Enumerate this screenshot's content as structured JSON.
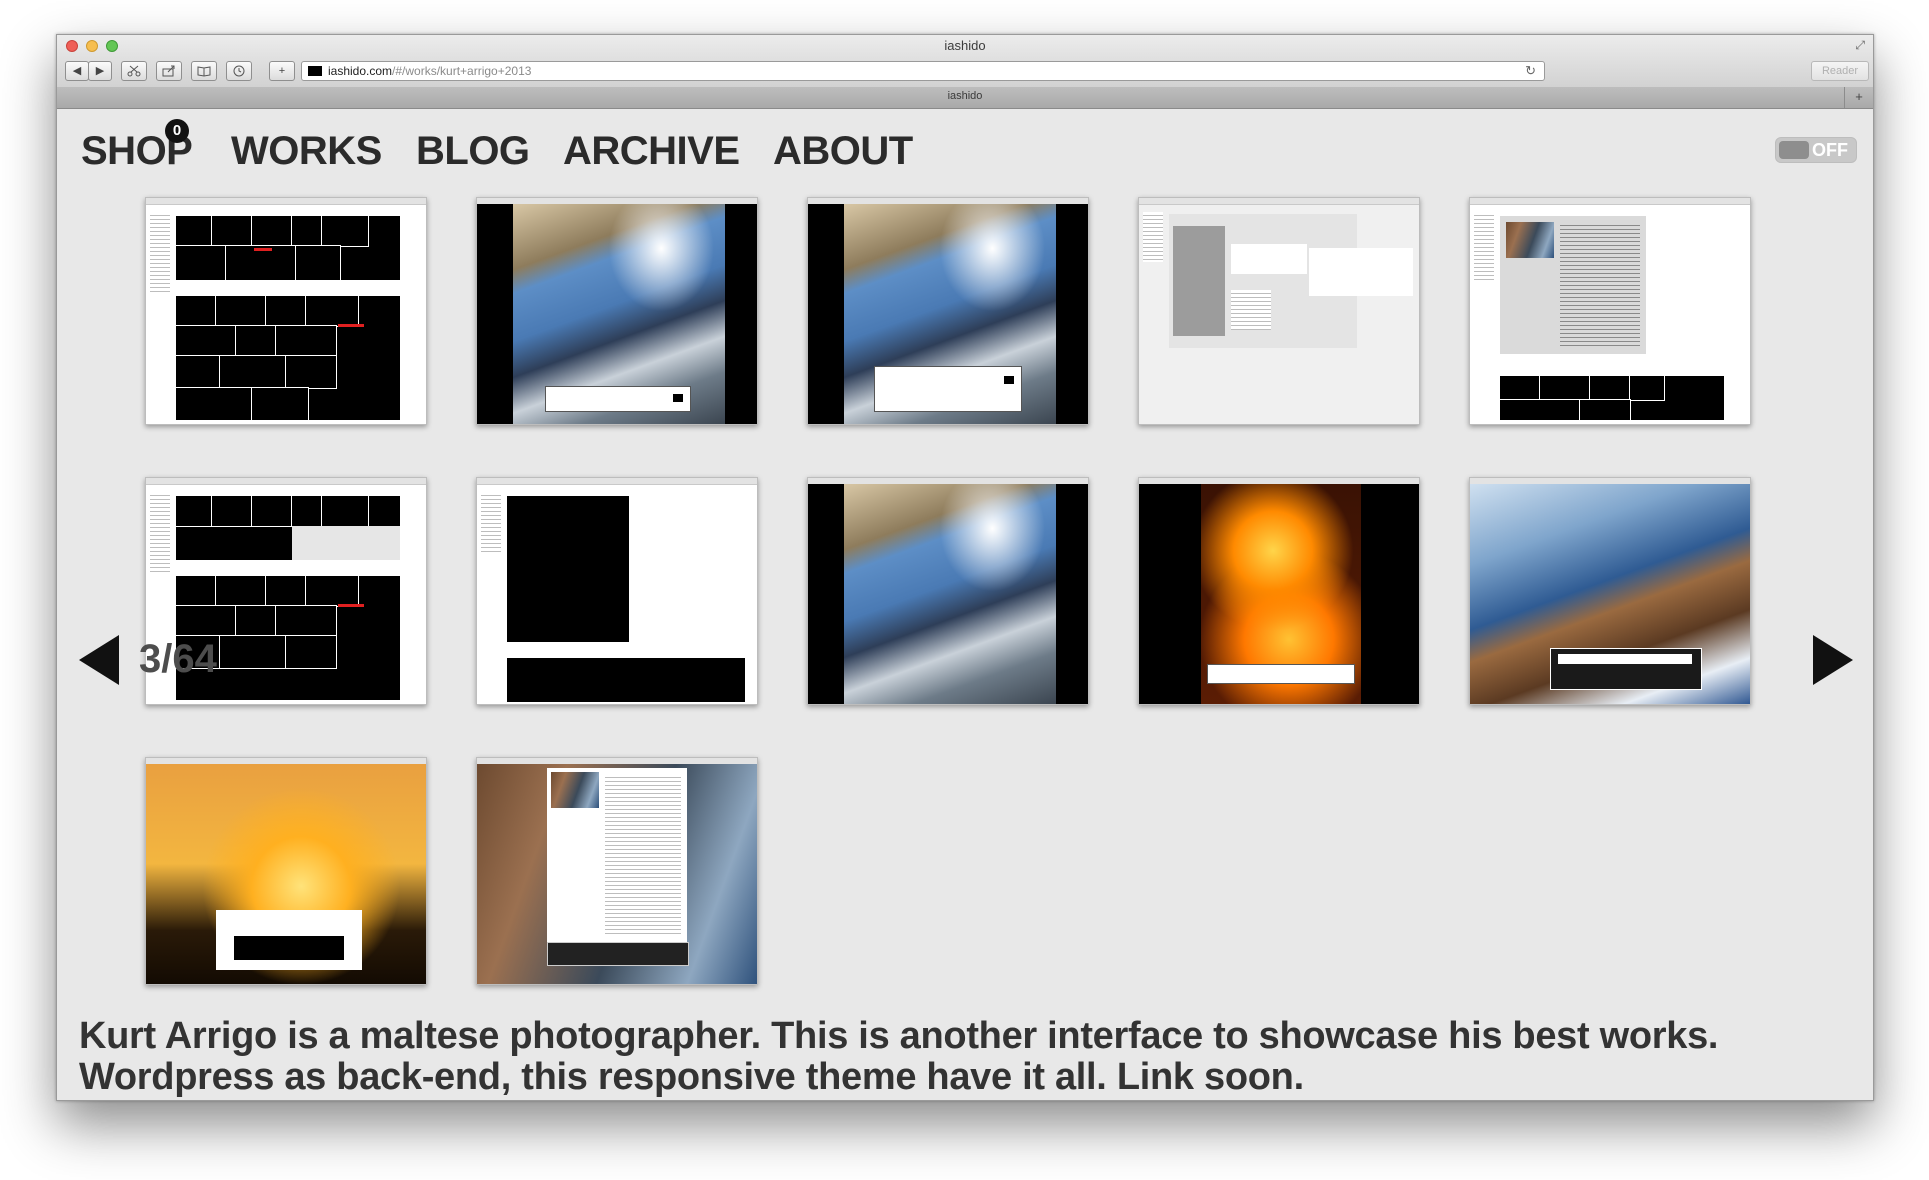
{
  "window": {
    "title": "iashido",
    "tab_title": "iashido",
    "url_host": "iashido.com",
    "url_path": "/#/works/kurt+arrigo+2013",
    "reader_label": "Reader",
    "tab_add_label": "+"
  },
  "toolbar": {
    "back_label": "◀",
    "forward_label": "▶",
    "add_label": "+",
    "reload_label": "↻",
    "fullscreen_label": "⤢"
  },
  "nav": {
    "shop": "SHOP",
    "cart_count": "0",
    "works": "WORKS",
    "blog": "BLOG",
    "archive": "ARCHIVE",
    "about": "ABOUT"
  },
  "toggle": {
    "label": "OFF"
  },
  "counter": {
    "current": "3",
    "separator": "/",
    "total": "64"
  },
  "gallery": {
    "thumbnails": [
      {
        "kind": "grid"
      },
      {
        "kind": "sail-photo"
      },
      {
        "kind": "sail-photo"
      },
      {
        "kind": "gray-layout"
      },
      {
        "kind": "profile"
      },
      {
        "kind": "grid"
      },
      {
        "kind": "black-blocks"
      },
      {
        "kind": "sail-photo"
      },
      {
        "kind": "coral-photo"
      },
      {
        "kind": "boat-photo"
      },
      {
        "kind": "sunset-photo"
      },
      {
        "kind": "deck-profile"
      }
    ]
  },
  "caption": {
    "line1": "Kurt Arrigo is a maltese photographer. This is another interface to showcase his best works.",
    "line2": "Wordpress as back-end, this responsive theme have it all. Link soon."
  },
  "icons": {
    "prev": "left-triangle-arrow",
    "next": "right-triangle-arrow"
  }
}
